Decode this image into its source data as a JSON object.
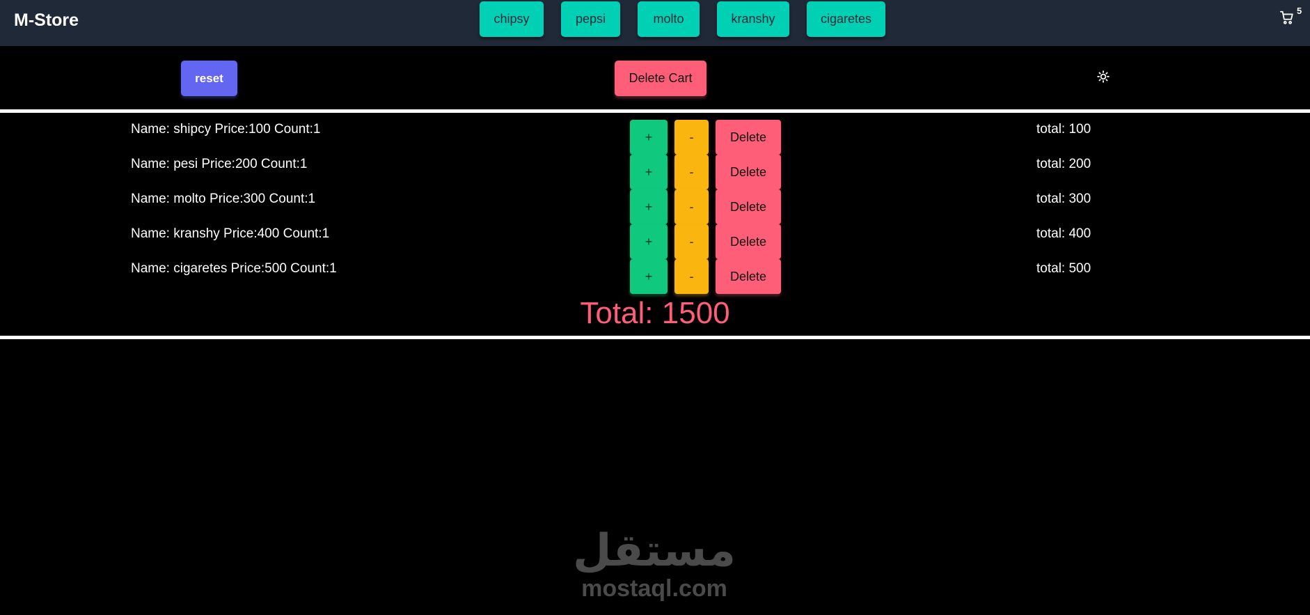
{
  "navbar": {
    "brand": "M-Store",
    "products": [
      {
        "label": "chipsy"
      },
      {
        "label": "pepsi"
      },
      {
        "label": "molto"
      },
      {
        "label": "kranshy"
      },
      {
        "label": "cigaretes"
      }
    ],
    "cart": {
      "icon": "cart-icon",
      "count": "5"
    }
  },
  "toolbar": {
    "reset_label": "reset",
    "delete_cart_label": "Delete Cart",
    "theme_icon": "sun-icon"
  },
  "cart_items": [
    {
      "info": "Name: shipcy Price:100 Count:1",
      "total": "total: 100"
    },
    {
      "info": "Name: pesi Price:200 Count:1",
      "total": "total: 200"
    },
    {
      "info": "Name: molto Price:300 Count:1",
      "total": "total: 300"
    },
    {
      "info": "Name: kranshy Price:400 Count:1",
      "total": "total: 400"
    },
    {
      "info": "Name: cigaretes Price:500 Count:1",
      "total": "total: 500"
    }
  ],
  "row_actions": {
    "plus_label": "+",
    "minus_label": "-",
    "delete_label": "Delete"
  },
  "grand_total": "Total: 1500",
  "watermark": {
    "arabic": "مستقل",
    "latin": "mostaql.com"
  },
  "colors": {
    "navbar_bg": "#1f2937",
    "product_button": "#00d1b5",
    "reset_button": "#6366f1",
    "delete_button": "#ff5e78",
    "plus_button": "#10c97f",
    "minus_button": "#fbb50f",
    "total_text": "#ff5e78"
  }
}
